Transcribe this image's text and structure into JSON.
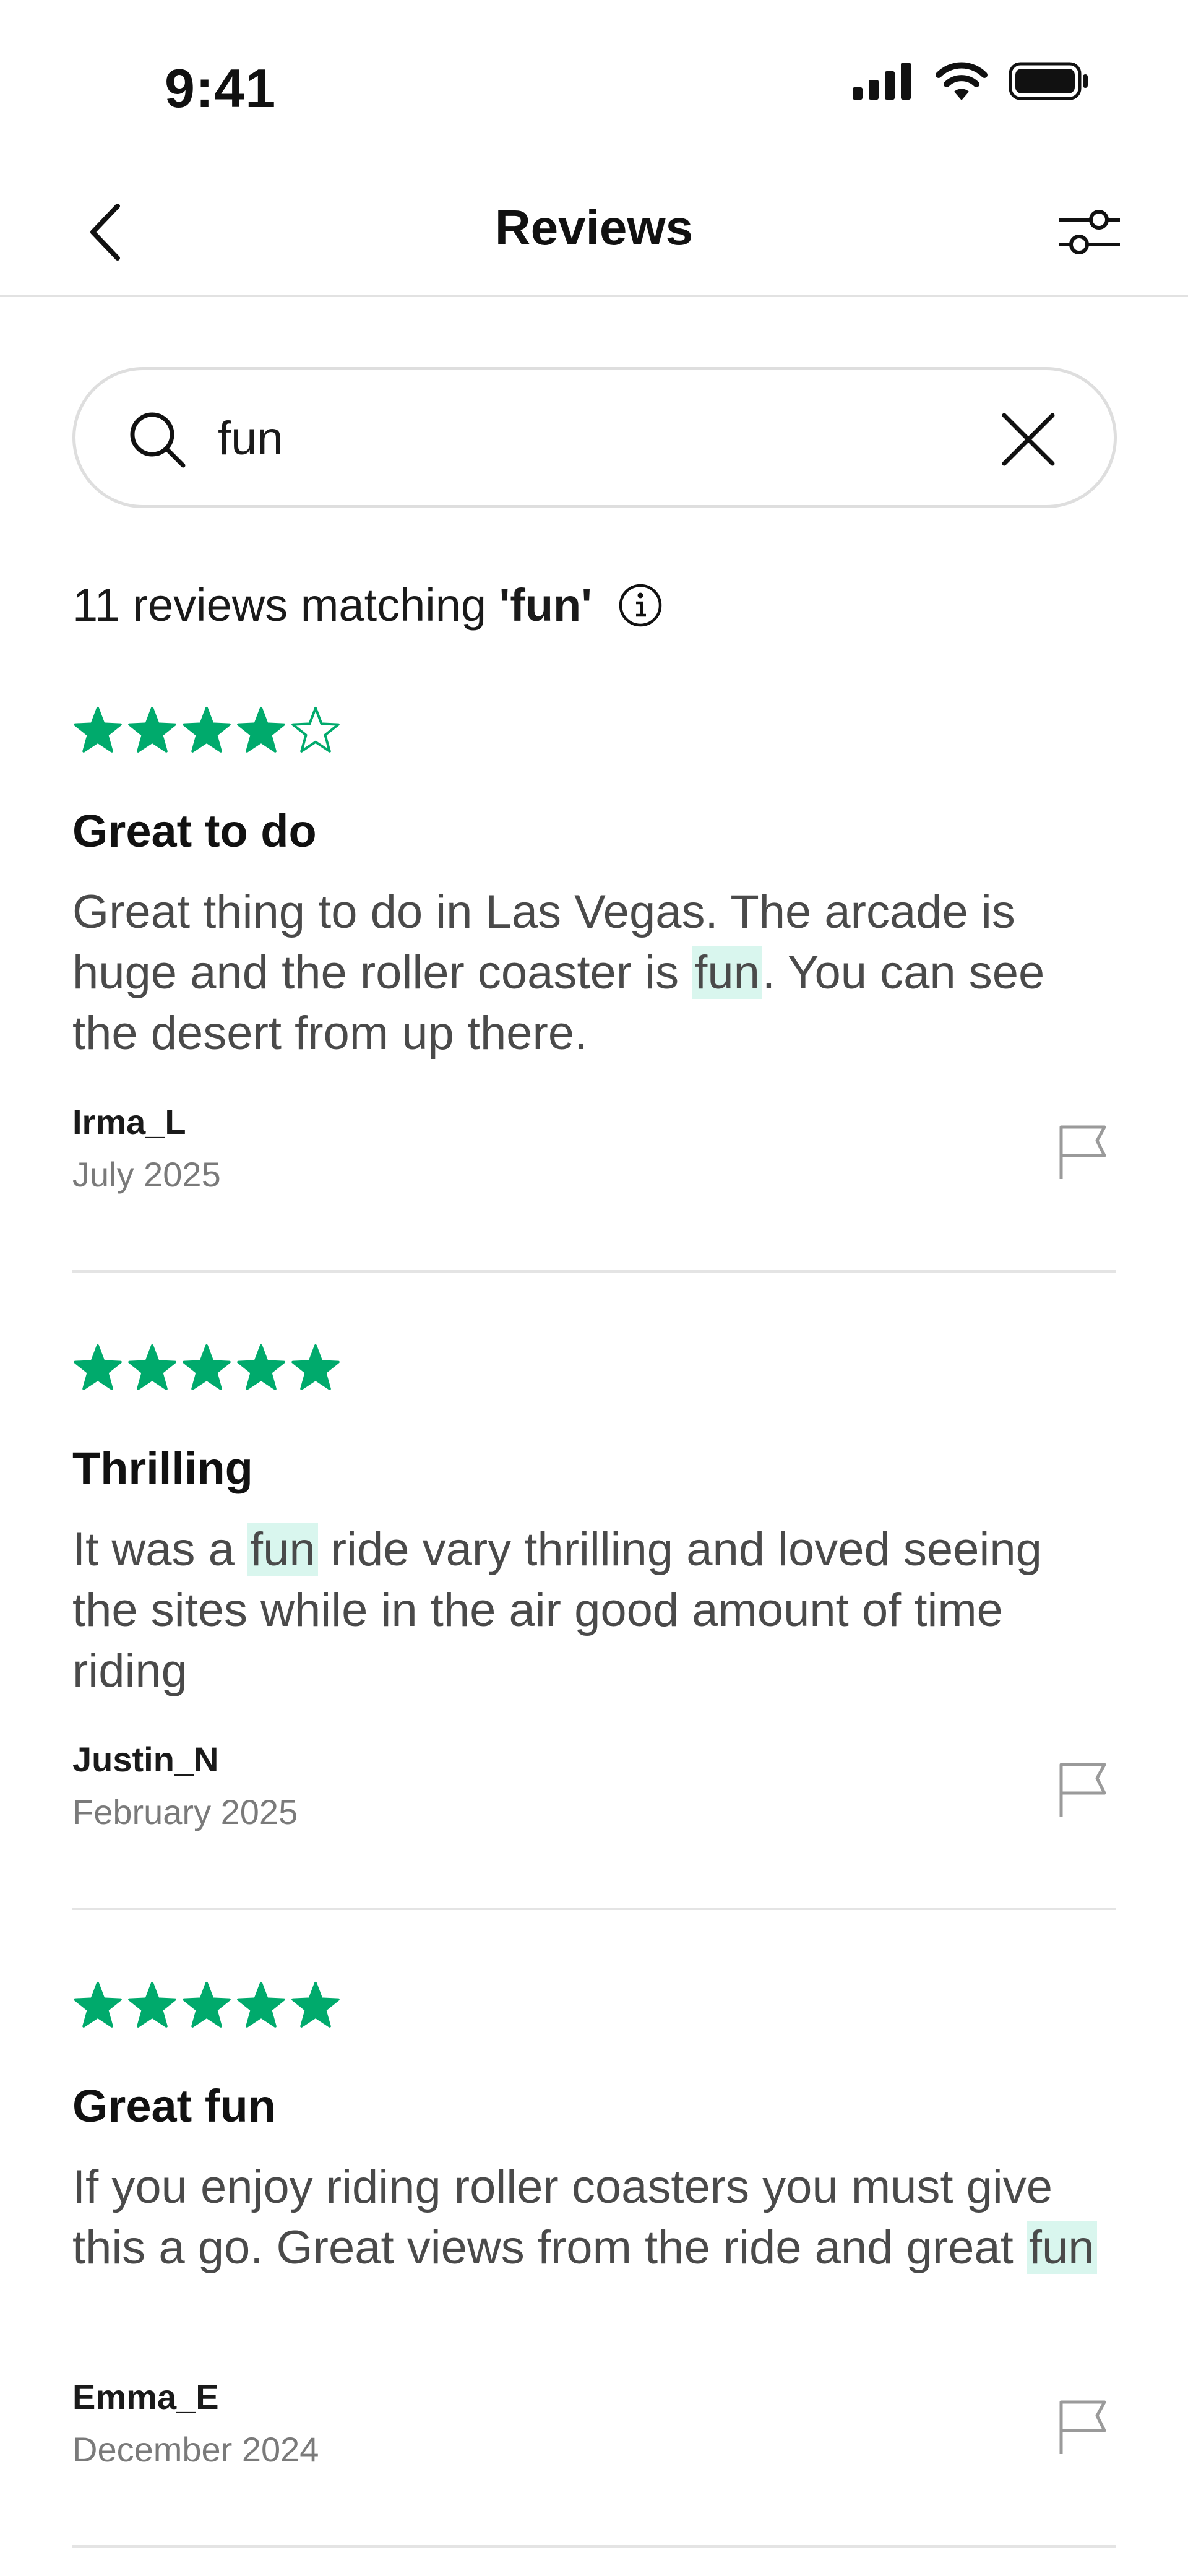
{
  "status_bar": {
    "time": "9:41",
    "icons": [
      "signal-icon",
      "wifi-icon",
      "battery-icon"
    ]
  },
  "nav": {
    "title": "Reviews",
    "back_icon": "chevron-left-icon",
    "filter_icon": "sliders-icon"
  },
  "search": {
    "value": "fun",
    "icon": "search-icon",
    "clear_icon": "close-icon"
  },
  "results": {
    "prefix": "11 reviews matching ",
    "query": "'fun'",
    "info_icon": "info-icon"
  },
  "colors": {
    "star": "#00AA6C",
    "highlight": "#D9F6EE",
    "body_text": "#4A4A4A",
    "muted": "#7A7A7A",
    "divider": "#E4E4E4"
  },
  "reviews": [
    {
      "rating": 4,
      "title": "Great to do",
      "body": {
        "before": "Great thing to do in Las Vegas. The arcade is huge and the roller coaster is ",
        "match": "fun",
        "after": ". You can see the desert from up there."
      },
      "author": "Irma_L",
      "date": "July 2025"
    },
    {
      "rating": 5,
      "title": "Thrilling",
      "body": {
        "before": "It was a ",
        "match": "fun",
        "after": " ride vary thrilling and loved seeing the sites while in the air good amount of time riding"
      },
      "author": "Justin_N",
      "date": "February 2025"
    },
    {
      "rating": 5,
      "title": "Great fun",
      "body": {
        "before": "If you enjoy riding roller coasters you must give this a go. Great views from the ride and great ",
        "match": "fun",
        "after": ""
      },
      "author": "Emma_E",
      "date": "December 2024"
    }
  ]
}
